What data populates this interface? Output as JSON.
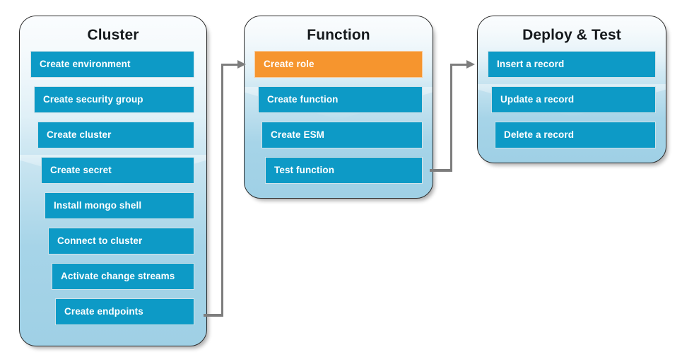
{
  "diagram": {
    "title": "Cluster to Function to Deploy and Test workflow",
    "colors": {
      "step_blue": "#0d9ac6",
      "step_orange": "#f6952e",
      "panel_top": "#f4f9fc",
      "panel_bottom": "#9fd0e5",
      "connector_gray": "#7d7d7d",
      "text_dark": "#15191c",
      "text_light": "#ffffff"
    },
    "panels": [
      {
        "id": "cluster",
        "title": "Cluster",
        "steps": [
          {
            "label": "Create environment",
            "highlighted": false
          },
          {
            "label": "Create security group",
            "highlighted": false
          },
          {
            "label": "Create cluster",
            "highlighted": false
          },
          {
            "label": "Create secret",
            "highlighted": false
          },
          {
            "label": "Install mongo shell",
            "highlighted": false
          },
          {
            "label": "Connect to cluster",
            "highlighted": false
          },
          {
            "label": "Activate change streams",
            "highlighted": false
          },
          {
            "label": "Create endpoints",
            "highlighted": false
          }
        ]
      },
      {
        "id": "function",
        "title": "Function",
        "steps": [
          {
            "label": "Create role",
            "highlighted": true
          },
          {
            "label": "Create function",
            "highlighted": false
          },
          {
            "label": "Create ESM",
            "highlighted": false
          },
          {
            "label": "Test function",
            "highlighted": false
          }
        ]
      },
      {
        "id": "deploy-test",
        "title": "Deploy & Test",
        "steps": [
          {
            "label": "Insert a record",
            "highlighted": false
          },
          {
            "label": "Update a record",
            "highlighted": false
          },
          {
            "label": "Delete a record",
            "highlighted": false
          }
        ]
      }
    ],
    "connectors": [
      {
        "id": "cluster-to-function",
        "from": "Create endpoints",
        "to": "Create role"
      },
      {
        "id": "function-to-deploy",
        "from": "Test function",
        "to": "Insert a record"
      }
    ]
  }
}
